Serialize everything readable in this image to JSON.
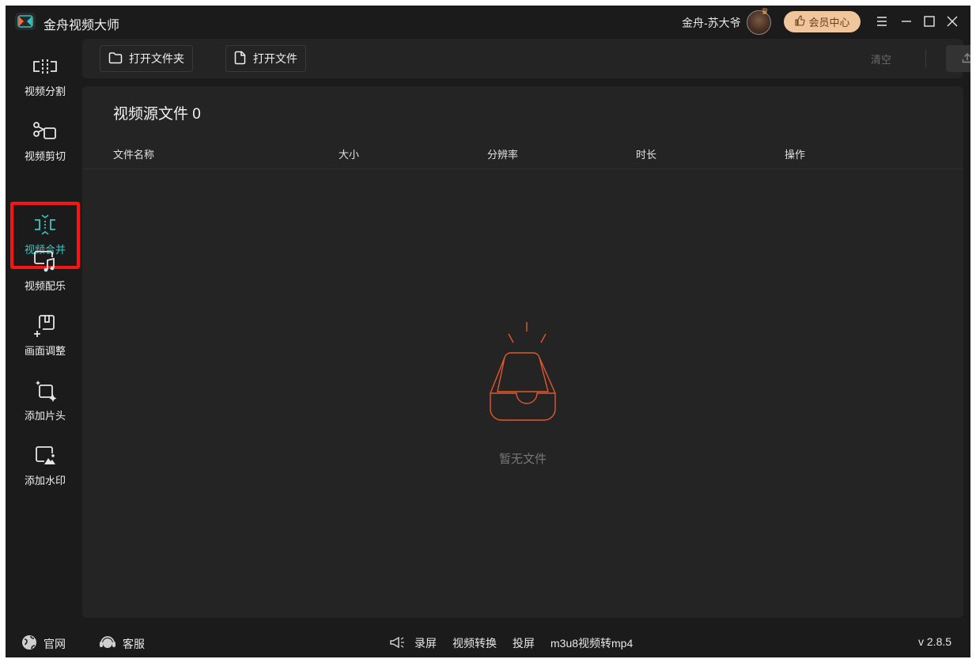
{
  "app": {
    "title": "金舟视频大师",
    "username": "金舟-苏大爷",
    "vip_label": "会员中心"
  },
  "sidebar": {
    "items": [
      {
        "label": "视频分割",
        "icon": "split-icon"
      },
      {
        "label": "视频剪切",
        "icon": "scissors-icon"
      },
      {
        "label": "视频合并",
        "icon": "merge-icon",
        "active": true
      },
      {
        "label": "视频配乐",
        "icon": "music-icon"
      },
      {
        "label": "画面调整",
        "icon": "crop-adjust-icon"
      },
      {
        "label": "添加片头",
        "icon": "intro-sparkle-icon"
      },
      {
        "label": "添加水印",
        "icon": "watermark-image-icon"
      }
    ]
  },
  "toolbar": {
    "open_folder_label": "打开文件夹",
    "open_file_label": "打开文件",
    "clear_label": "清空",
    "export_label": "导出"
  },
  "main": {
    "section_title": "视频源文件 0",
    "columns": [
      "文件名称",
      "大小",
      "分辨率",
      "时长",
      "操作"
    ],
    "empty_text": "暂无文件"
  },
  "statusbar": {
    "website_label": "官网",
    "support_label": "客服",
    "links": [
      "录屏",
      "视频转换",
      "投屏",
      "m3u8视频转mp4"
    ],
    "version": "v 2.8.5"
  },
  "colors": {
    "accent": "#39c5c2",
    "highlight_border": "#ff1212",
    "empty_icon": "#e2572e",
    "vip_bg": "#f0c69c"
  }
}
